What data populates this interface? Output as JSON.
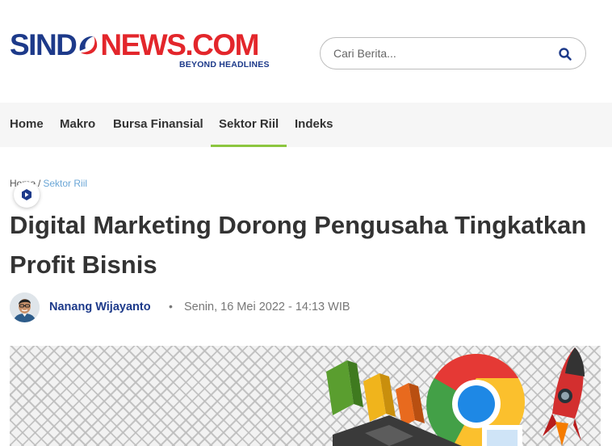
{
  "brand": {
    "logo_left": "SIND",
    "logo_right": "NEWS.COM",
    "tagline": "BEYOND HEADLINES",
    "colors": {
      "blue": "#1d3a8a",
      "red": "#e3262b",
      "accent_green": "#8cc63f"
    }
  },
  "search": {
    "placeholder": "Cari Berita...",
    "icon": "search-icon"
  },
  "nav": {
    "items": [
      {
        "label": "Home"
      },
      {
        "label": "Makro"
      },
      {
        "label": "Bursa Finansial"
      },
      {
        "label": "Sektor Riil",
        "active": true
      },
      {
        "label": "Indeks"
      }
    ]
  },
  "breadcrumb": {
    "home": "Home",
    "separator": "/",
    "current": "Sektor Riil"
  },
  "article": {
    "title": "Digital Marketing Dorong Pengusaha Tingkatkan Profit Bisnis",
    "author": "Nanang Wijayanto",
    "separator": "•",
    "date": "Senin, 16 Mei 2022 - 14:13 WIB"
  }
}
